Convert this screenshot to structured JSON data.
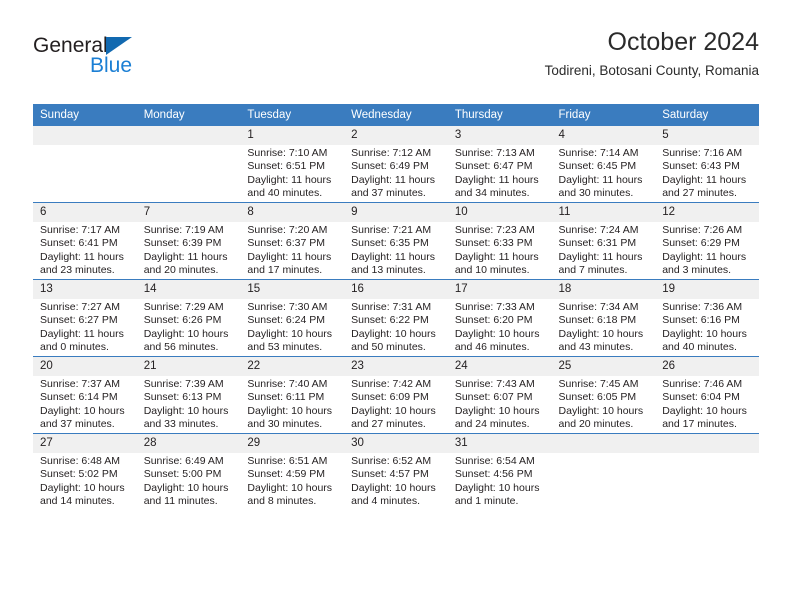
{
  "brand": {
    "name_top": "General",
    "name_bottom": "Blue",
    "accent_color": "#1269b0",
    "blue_text_color": "#1b7fd4"
  },
  "header": {
    "title": "October 2024",
    "subtitle": "Todireni, Botosani County, Romania"
  },
  "calendar": {
    "header_bg": "#3a7cbf",
    "daynum_bg": "#f0f0f0",
    "weekday_headers": [
      "Sunday",
      "Monday",
      "Tuesday",
      "Wednesday",
      "Thursday",
      "Friday",
      "Saturday"
    ],
    "weeks": [
      [
        {
          "day": "",
          "sunrise": "",
          "sunset": "",
          "daylight": "",
          "empty": true
        },
        {
          "day": "",
          "sunrise": "",
          "sunset": "",
          "daylight": "",
          "empty": true
        },
        {
          "day": "1",
          "sunrise": "Sunrise: 7:10 AM",
          "sunset": "Sunset: 6:51 PM",
          "daylight": "Daylight: 11 hours and 40 minutes."
        },
        {
          "day": "2",
          "sunrise": "Sunrise: 7:12 AM",
          "sunset": "Sunset: 6:49 PM",
          "daylight": "Daylight: 11 hours and 37 minutes."
        },
        {
          "day": "3",
          "sunrise": "Sunrise: 7:13 AM",
          "sunset": "Sunset: 6:47 PM",
          "daylight": "Daylight: 11 hours and 34 minutes."
        },
        {
          "day": "4",
          "sunrise": "Sunrise: 7:14 AM",
          "sunset": "Sunset: 6:45 PM",
          "daylight": "Daylight: 11 hours and 30 minutes."
        },
        {
          "day": "5",
          "sunrise": "Sunrise: 7:16 AM",
          "sunset": "Sunset: 6:43 PM",
          "daylight": "Daylight: 11 hours and 27 minutes."
        }
      ],
      [
        {
          "day": "6",
          "sunrise": "Sunrise: 7:17 AM",
          "sunset": "Sunset: 6:41 PM",
          "daylight": "Daylight: 11 hours and 23 minutes."
        },
        {
          "day": "7",
          "sunrise": "Sunrise: 7:19 AM",
          "sunset": "Sunset: 6:39 PM",
          "daylight": "Daylight: 11 hours and 20 minutes."
        },
        {
          "day": "8",
          "sunrise": "Sunrise: 7:20 AM",
          "sunset": "Sunset: 6:37 PM",
          "daylight": "Daylight: 11 hours and 17 minutes."
        },
        {
          "day": "9",
          "sunrise": "Sunrise: 7:21 AM",
          "sunset": "Sunset: 6:35 PM",
          "daylight": "Daylight: 11 hours and 13 minutes."
        },
        {
          "day": "10",
          "sunrise": "Sunrise: 7:23 AM",
          "sunset": "Sunset: 6:33 PM",
          "daylight": "Daylight: 11 hours and 10 minutes."
        },
        {
          "day": "11",
          "sunrise": "Sunrise: 7:24 AM",
          "sunset": "Sunset: 6:31 PM",
          "daylight": "Daylight: 11 hours and 7 minutes."
        },
        {
          "day": "12",
          "sunrise": "Sunrise: 7:26 AM",
          "sunset": "Sunset: 6:29 PM",
          "daylight": "Daylight: 11 hours and 3 minutes."
        }
      ],
      [
        {
          "day": "13",
          "sunrise": "Sunrise: 7:27 AM",
          "sunset": "Sunset: 6:27 PM",
          "daylight": "Daylight: 11 hours and 0 minutes."
        },
        {
          "day": "14",
          "sunrise": "Sunrise: 7:29 AM",
          "sunset": "Sunset: 6:26 PM",
          "daylight": "Daylight: 10 hours and 56 minutes."
        },
        {
          "day": "15",
          "sunrise": "Sunrise: 7:30 AM",
          "sunset": "Sunset: 6:24 PM",
          "daylight": "Daylight: 10 hours and 53 minutes."
        },
        {
          "day": "16",
          "sunrise": "Sunrise: 7:31 AM",
          "sunset": "Sunset: 6:22 PM",
          "daylight": "Daylight: 10 hours and 50 minutes."
        },
        {
          "day": "17",
          "sunrise": "Sunrise: 7:33 AM",
          "sunset": "Sunset: 6:20 PM",
          "daylight": "Daylight: 10 hours and 46 minutes."
        },
        {
          "day": "18",
          "sunrise": "Sunrise: 7:34 AM",
          "sunset": "Sunset: 6:18 PM",
          "daylight": "Daylight: 10 hours and 43 minutes."
        },
        {
          "day": "19",
          "sunrise": "Sunrise: 7:36 AM",
          "sunset": "Sunset: 6:16 PM",
          "daylight": "Daylight: 10 hours and 40 minutes."
        }
      ],
      [
        {
          "day": "20",
          "sunrise": "Sunrise: 7:37 AM",
          "sunset": "Sunset: 6:14 PM",
          "daylight": "Daylight: 10 hours and 37 minutes."
        },
        {
          "day": "21",
          "sunrise": "Sunrise: 7:39 AM",
          "sunset": "Sunset: 6:13 PM",
          "daylight": "Daylight: 10 hours and 33 minutes."
        },
        {
          "day": "22",
          "sunrise": "Sunrise: 7:40 AM",
          "sunset": "Sunset: 6:11 PM",
          "daylight": "Daylight: 10 hours and 30 minutes."
        },
        {
          "day": "23",
          "sunrise": "Sunrise: 7:42 AM",
          "sunset": "Sunset: 6:09 PM",
          "daylight": "Daylight: 10 hours and 27 minutes."
        },
        {
          "day": "24",
          "sunrise": "Sunrise: 7:43 AM",
          "sunset": "Sunset: 6:07 PM",
          "daylight": "Daylight: 10 hours and 24 minutes."
        },
        {
          "day": "25",
          "sunrise": "Sunrise: 7:45 AM",
          "sunset": "Sunset: 6:05 PM",
          "daylight": "Daylight: 10 hours and 20 minutes."
        },
        {
          "day": "26",
          "sunrise": "Sunrise: 7:46 AM",
          "sunset": "Sunset: 6:04 PM",
          "daylight": "Daylight: 10 hours and 17 minutes."
        }
      ],
      [
        {
          "day": "27",
          "sunrise": "Sunrise: 6:48 AM",
          "sunset": "Sunset: 5:02 PM",
          "daylight": "Daylight: 10 hours and 14 minutes."
        },
        {
          "day": "28",
          "sunrise": "Sunrise: 6:49 AM",
          "sunset": "Sunset: 5:00 PM",
          "daylight": "Daylight: 10 hours and 11 minutes."
        },
        {
          "day": "29",
          "sunrise": "Sunrise: 6:51 AM",
          "sunset": "Sunset: 4:59 PM",
          "daylight": "Daylight: 10 hours and 8 minutes."
        },
        {
          "day": "30",
          "sunrise": "Sunrise: 6:52 AM",
          "sunset": "Sunset: 4:57 PM",
          "daylight": "Daylight: 10 hours and 4 minutes."
        },
        {
          "day": "31",
          "sunrise": "Sunrise: 6:54 AM",
          "sunset": "Sunset: 4:56 PM",
          "daylight": "Daylight: 10 hours and 1 minute."
        },
        {
          "day": "",
          "sunrise": "",
          "sunset": "",
          "daylight": "",
          "empty": true
        },
        {
          "day": "",
          "sunrise": "",
          "sunset": "",
          "daylight": "",
          "empty": true
        }
      ]
    ]
  }
}
